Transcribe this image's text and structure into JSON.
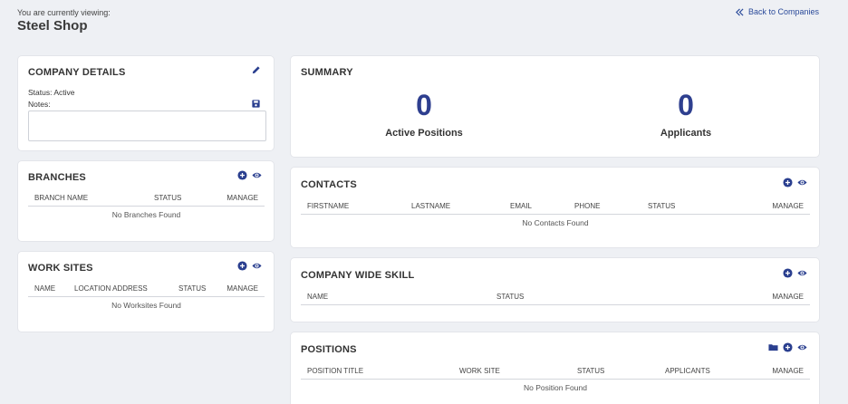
{
  "header": {
    "viewing_label": "You are currently viewing:",
    "company_name": "Steel Shop",
    "back_link": "Back to Companies"
  },
  "company_details": {
    "title": "COMPANY DETAILS",
    "status": "Status: Active",
    "notes_label": "Notes:",
    "notes_value": ""
  },
  "branches": {
    "title": "BRANCHES",
    "columns": [
      "BRANCH NAME",
      "STATUS",
      "MANAGE"
    ],
    "empty": "No Branches Found"
  },
  "work_sites": {
    "title": "WORK SITES",
    "columns": [
      "NAME",
      "LOCATION ADDRESS",
      "STATUS",
      "MANAGE"
    ],
    "empty": "No Worksites Found"
  },
  "summary": {
    "title": "SUMMARY",
    "active_positions_count": "0",
    "active_positions_label": "Active Positions",
    "applicants_count": "0",
    "applicants_label": "Applicants"
  },
  "contacts": {
    "title": "CONTACTS",
    "columns": [
      "FIRSTNAME",
      "LASTNAME",
      "EMAIL",
      "PHONE",
      "STATUS",
      "MANAGE"
    ],
    "empty": "No Contacts Found"
  },
  "company_wide_skill": {
    "title": "COMPANY WIDE SKILL",
    "columns": [
      "NAME",
      "STATUS",
      "MANAGE"
    ]
  },
  "positions": {
    "title": "POSITIONS",
    "columns": [
      "POSITION TITLE",
      "WORK SITE",
      "STATUS",
      "APPLICANTS",
      "MANAGE"
    ],
    "empty": "No Position Found"
  },
  "colors": {
    "accent": "#2e3f8f",
    "icon": "#2a3f8f",
    "background": "#eef0f4",
    "card": "#ffffff"
  },
  "icons": [
    "angles-left-icon",
    "pencil-icon",
    "save-icon",
    "plus-circle-icon",
    "eye-icon",
    "folder-icon"
  ]
}
